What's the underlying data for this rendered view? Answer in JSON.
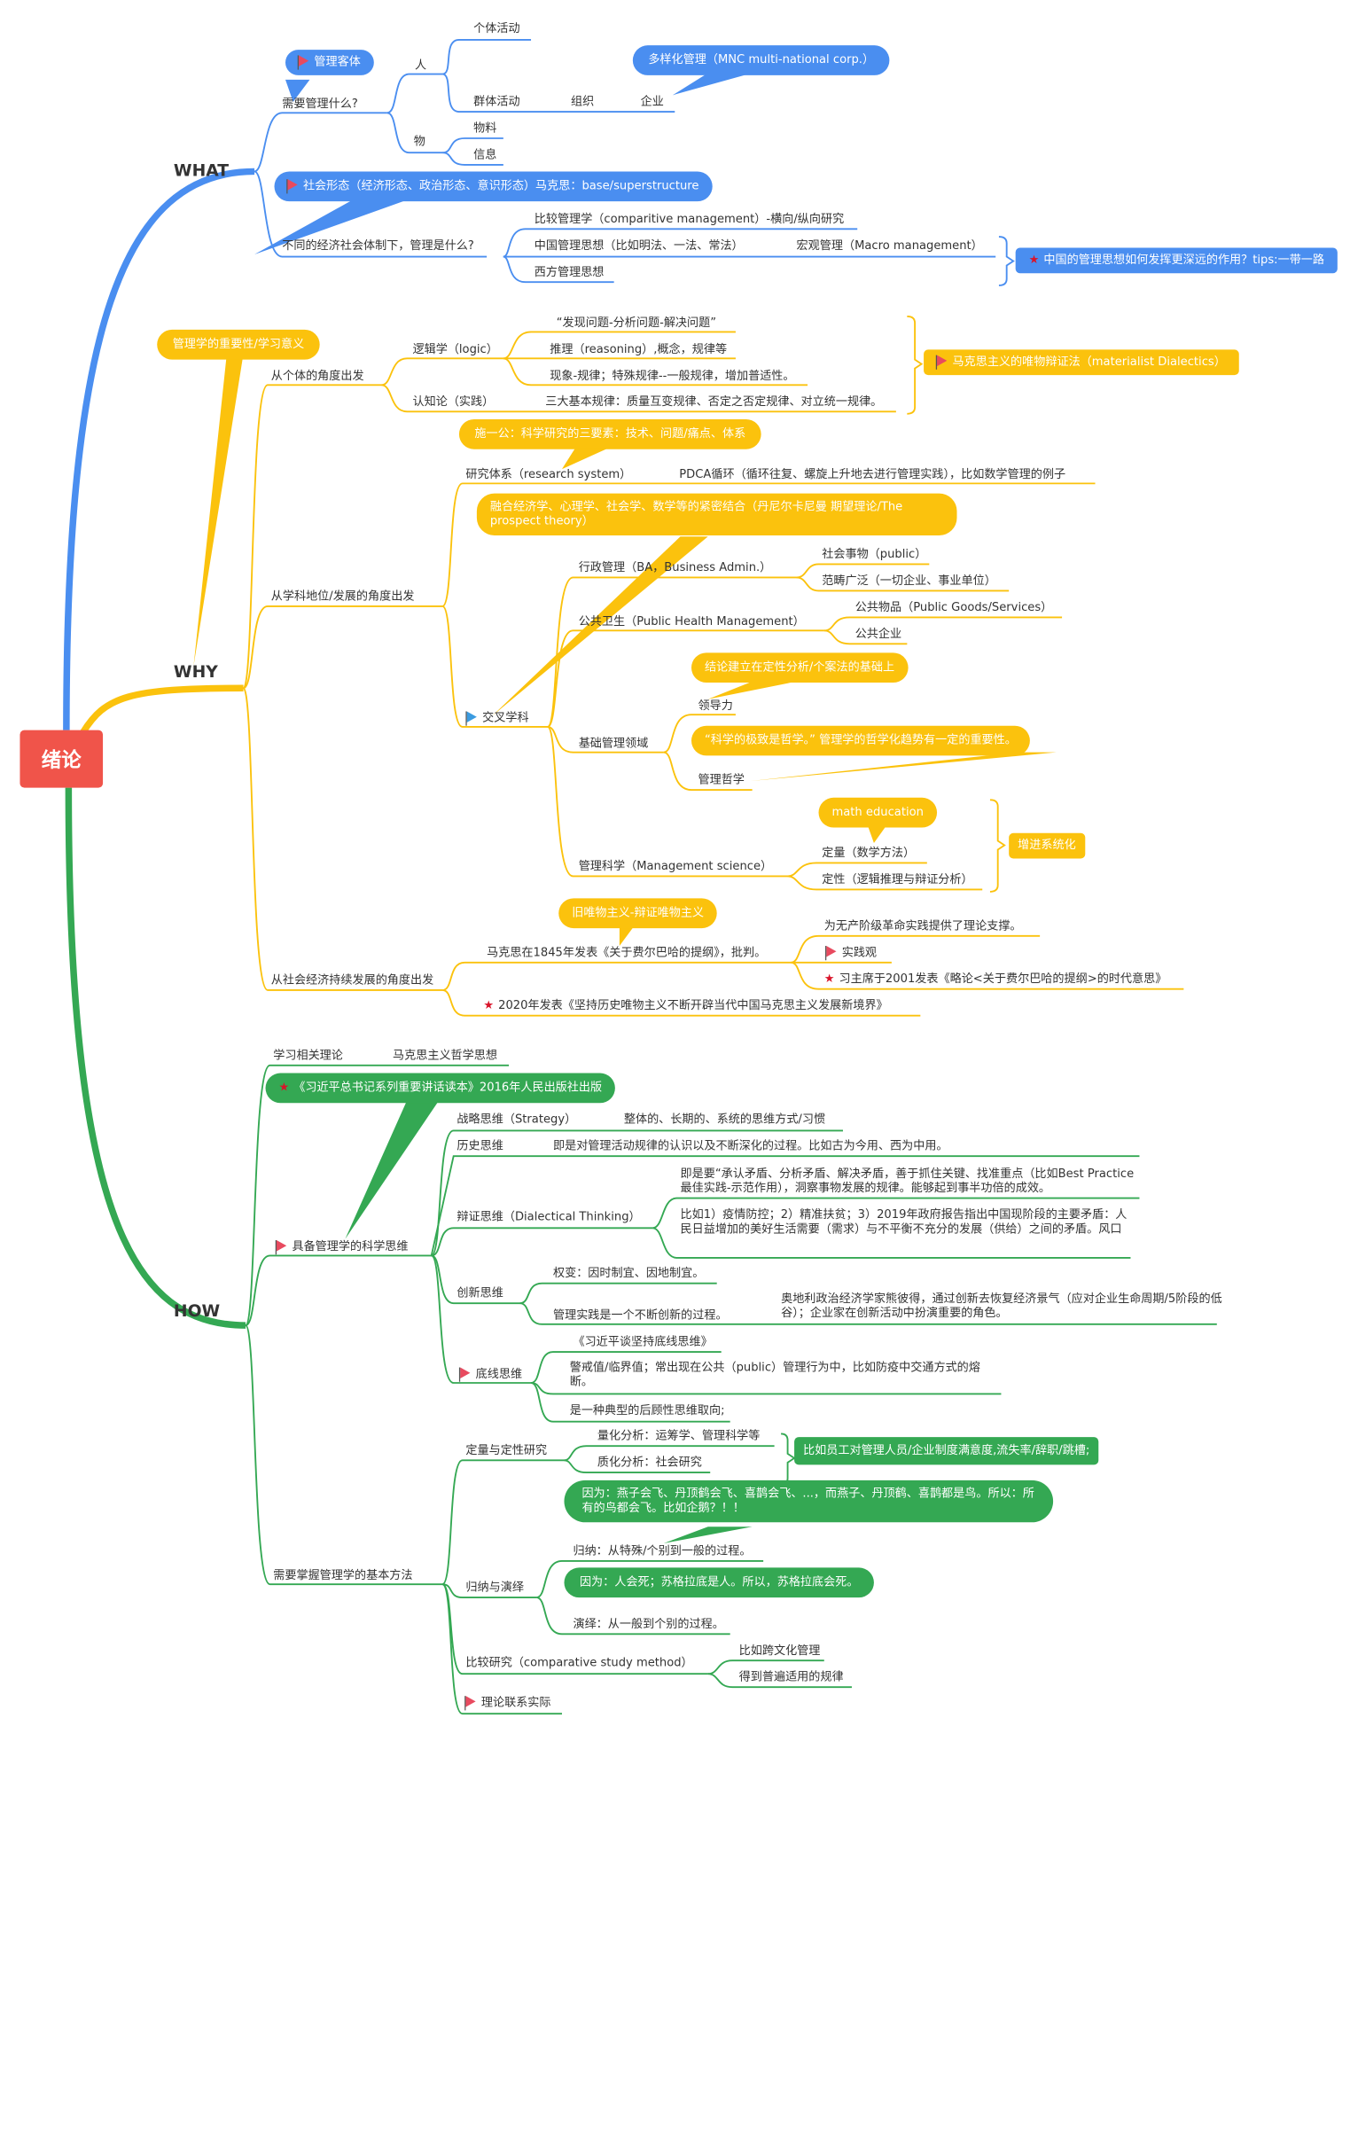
{
  "root": {
    "label": "绪论"
  },
  "colors": {
    "root": "#f0544a",
    "what": "#4a8ef0",
    "why": "#fbc20d",
    "how": "#34a853",
    "flag": "#e84a5f",
    "star": "#d9142a"
  },
  "what": {
    "label": "WHAT",
    "q1": "需要管理什么?",
    "q1_callout": "管理客体",
    "person": "人",
    "individual": "个体活动",
    "group": "群体活动",
    "org": "组织",
    "enterprise": "企业",
    "enterprise_callout": "多样化管理（MNC multi-national corp.）",
    "thing": "物",
    "material": "物料",
    "info": "信息",
    "q2_callout": "社会形态（经济形态、政治形态、意识形态）马克思：base/superstructure",
    "q2": "不同的经济社会体制下，管理是什么?",
    "compare": "比较管理学（comparitive management）-横向/纵向研究",
    "china": "中国管理思想（比如明法、一法、常法）",
    "macro": "宏观管理（Macro management）",
    "west": "西方管理思想",
    "summary": "中国的管理思想如何发挥更深远的作用？tips:一带一路"
  },
  "why": {
    "label": "WHY",
    "callout": "管理学的重要性/学习意义",
    "individual": "从个体的角度出发",
    "logic": "逻辑学（logic）",
    "logic_items": [
      "“发现问题-分析问题-解决问题”",
      "推理（reasoning）,概念，规律等",
      "现象-规律；特殊规律--一般规律，增加普适性。"
    ],
    "epistem": "认知论（实践）",
    "epistem_item": "三大基本规律：质量互变规律、否定之否定规律、对立统一规律。",
    "marx_summary": "马克思主义的唯物辩证法（materialist Dialectics）",
    "discipline": "从学科地位/发展的角度出发",
    "shi_callout": "施一公：科学研究的三要素：技术、问题/痛点、体系",
    "research": "研究体系（research system）",
    "pdca": "PDCA循环（循环往复、螺旋上升地去进行管理实践），比如数学管理的例子",
    "inter_callout": "融合经济学、心理学、社会学、数学等的紧密结合（丹尼尔卡尼曼 期望理论/The prospect theory）",
    "inter": "交叉学科",
    "ba": "行政管理（BA，Business Admin.）",
    "ba_items": [
      "社会事物（public）",
      "范畴广泛（一切企业、事业单位）"
    ],
    "ph": "公共卫生（Public Health Management）",
    "ph_items": [
      "公共物品（Public Goods/Services）",
      "公共企业"
    ],
    "basic": "基础管理领域",
    "lead_callout": "结论建立在定性分析/个案法的基础上",
    "lead": "领导力",
    "phil_callout": "“科学的极致是哲学。” 管理学的哲学化趋势有一定的重要性。",
    "phil": "管理哲学",
    "ms": "管理科学（Management science）",
    "math_callout": "math education",
    "ms_items": [
      "定量（数学方法）",
      "定性（逻辑推理与辩证分析）"
    ],
    "ms_summary": "增进系统化",
    "socio": "从社会经济持续发展的角度出发",
    "mat_callout": "旧唯物主义-辩证唯物主义",
    "marx1845": "马克思在1845年发表《关于费尔巴哈的提纲》，批判。",
    "m_items": [
      "为无产阶级革命实践提供了理论支撑。",
      "实践观",
      "习主席于2001发表《略论<关于费尔巴哈的提纲>的时代意思》"
    ],
    "y2020": "2020年发表《坚持历史唯物主义不断开辟当代中国马克思主义发展新境界》"
  },
  "how": {
    "label": "HOW",
    "related": "学习相关理论",
    "marx_phil": "马克思主义哲学思想",
    "xi_callout": "《习近平总书记系列重要讲话读本》2016年人民出版社出版",
    "sci": "具备管理学的科学思维",
    "strategy": "战略思维（Strategy）",
    "strategy_item": "整体的、长期的、系统的思维方式/习惯",
    "history": "历史思维",
    "history_item": "即是对管理活动规律的认识以及不断深化的过程。比如古为今用、西为中用。",
    "dialect": "辩证思维（Dialectical Thinking）",
    "dialect_items": [
      "即是要“承认矛盾、分析矛盾、解决矛盾，善于抓住关键、找准重点（比如Best Practice最佳实践-示范作用），洞察事物发展的规律。能够起到事半功倍的成效。",
      "比如1）疫情防控；2）精准扶贫；3）2019年政府报告指出中国现阶段的主要矛盾：人民日益增加的美好生活需要（需求）与不平衡不充分的发展（供给）之间的矛盾。风口"
    ],
    "innov": "创新思维",
    "innov_items": [
      "权变：因时制宜、因地制宜。",
      "管理实践是一个不断创新的过程。"
    ],
    "innov_note": "奥地利政治经济学家熊彼得，通过创新去恢复经济景气（应对企业生命周期/5阶段的低谷）；企业家在创新活动中扮演重要的角色。",
    "bottom": "底线思维",
    "bottom_items": [
      "《习近平谈坚持底线思维》",
      "警戒值/临界值；常出现在公共（public）管理行为中，比如防疫中交通方式的熔断。",
      "是一种典型的后顾性思维取向;"
    ],
    "methods": "需要掌握管理学的基本方法",
    "qq": "定量与定性研究",
    "qq_items": [
      "量化分析：运筹学、管理科学等",
      "质化分析：社会研究"
    ],
    "qq_summary": "比如员工对管理人员/企业制度满意度,流失率/辞职/跳槽;",
    "induct_callout": "因为：燕子会飞、丹顶鹤会飞、喜鹊会飞、...，而燕子、丹顶鹤、喜鹊都是鸟。所以：所有的鸟都会飞。比如企鹅？！！",
    "induct": "归纳与演绎",
    "induct_item": "归纳：从特殊/个别到一般的过程。",
    "deduct_callout": "因为：人会死；苏格拉底是人。所以，苏格拉底会死。",
    "deduct_item": "演绎：从一般到个别的过程。",
    "compare": "比较研究（comparative study method）",
    "compare_items": [
      "比如跨文化管理",
      "得到普遍适用的规律"
    ],
    "theory": "理论联系实际"
  }
}
